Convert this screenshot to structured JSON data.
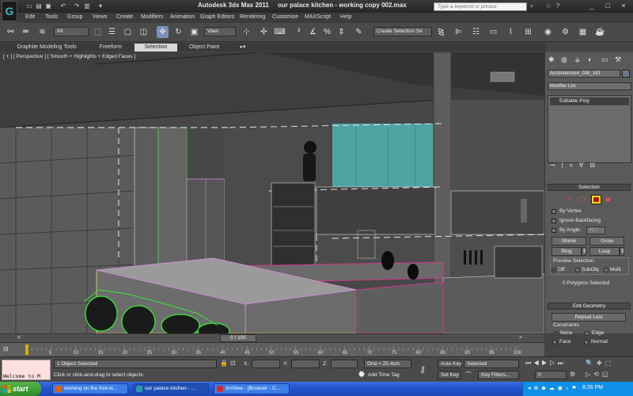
{
  "window": {
    "app_name": "Autodesk 3ds Max  2011",
    "file_title": "our palace kitchen - working copy 002.max",
    "search_placeholder": "Type a keyword or phrase"
  },
  "menu": [
    "Edit",
    "Tools",
    "Group",
    "Views",
    "Create",
    "Modifiers",
    "Animation",
    "Graph Editors",
    "Rendering",
    "Customize",
    "MAXScript",
    "Help"
  ],
  "toolbar": {
    "selection_filter": "All",
    "reference_coord": "View",
    "named_selection": "Create Selection Se"
  },
  "ribbon": {
    "tabs": [
      "Graphite Modeling Tools",
      "Freeform",
      "Selection",
      "Object Paint"
    ],
    "active_tab": "Selection"
  },
  "viewport": {
    "label": "[ + ] [ Perspective ] [ Smooth + Highlights + Edged Faces ]"
  },
  "command_panel": {
    "object_name": "Archinteriros4_008_193",
    "modifier_list": "Modifier List",
    "stack_item": "Editable Poly",
    "selection_rollout": "Selection",
    "by_vertex": "By Vertex",
    "ignore_backfacing": "Ignore Backfacing",
    "by_angle": "By Angle:",
    "by_angle_value": "45.0",
    "shrink": "Shrink",
    "grow": "Grow",
    "ring": "Ring",
    "loop": "Loop",
    "preview_selection": "Preview Selection",
    "preview_off": "Off",
    "preview_subobj": "SubObj",
    "preview_multi": "Multi",
    "selected_count": "0 Polygons Selected",
    "edit_geometry": "Edit Geometry",
    "repeat_last": "Repeat Last",
    "constraints": "Constraints",
    "c_none": "None",
    "c_edge": "Edge",
    "c_face": "Face",
    "c_normal": "Normal"
  },
  "timeline": {
    "frame_display": "0 / 100",
    "ticks": [
      "5",
      "10",
      "15",
      "20",
      "25",
      "30",
      "35",
      "40",
      "45",
      "50",
      "55",
      "60",
      "65",
      "70",
      "75",
      "80",
      "85",
      "90",
      "95",
      "100"
    ]
  },
  "status": {
    "listener_text": "Welcome to M",
    "objects_selected": "1 Object Selected",
    "prompt": "Click or click-and-drag to select objects",
    "x_label": "X:",
    "y_label": "Y:",
    "z_label": "Z:",
    "grid": "Grid = 25.4cm",
    "add_time_tag": "Add Time Tag",
    "auto_key": "Auto Key",
    "set_key": "Set Key",
    "key_mode": "Selected",
    "key_filters": "Key Filters...",
    "frame_value": "0"
  },
  "taskbar": {
    "start": "start",
    "tasks": [
      "working on the free ki...",
      "our palace kitchen - ...",
      "XnView - [Browser - C..."
    ],
    "active_task": "our palace kitchen - ...",
    "clock": "8:26 PM"
  },
  "colors": {
    "selection_green": "#39e639",
    "edge_magenta": "#cc3a8a",
    "edge_yellow": "#e6c84a",
    "glass_teal": "#4fa3a3",
    "listener_bg": "#ffe0e0",
    "taskbar_blue": "#2356d1"
  }
}
